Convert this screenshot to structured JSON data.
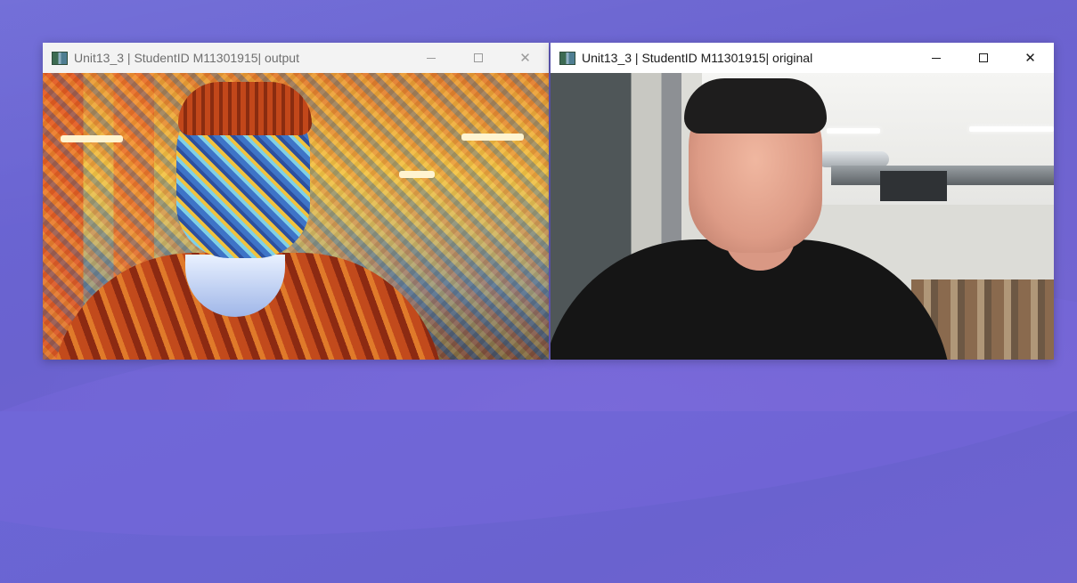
{
  "desktop": {
    "accent_color": "#6b67d6"
  },
  "windows": [
    {
      "title": "Unit13_3 | StudentID M11301915| output",
      "active": false,
      "content": "stylized webcam frame"
    },
    {
      "title": "Unit13_3 | StudentID M11301915| original",
      "active": true,
      "content": "webcam frame"
    }
  ],
  "controls": {
    "minimize_icon": "minimize-icon",
    "maximize_icon": "maximize-icon",
    "close_icon": "close-icon",
    "close_glyph": "✕"
  }
}
